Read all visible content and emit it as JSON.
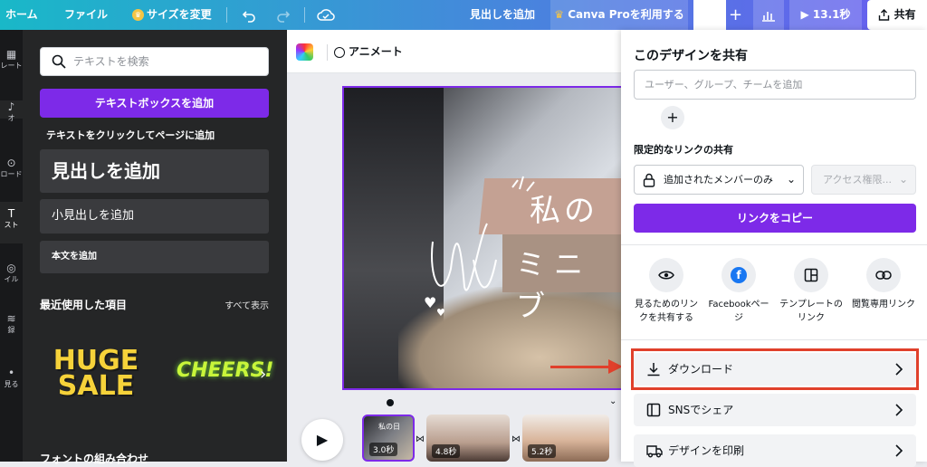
{
  "topbar": {
    "home": "ホーム",
    "file": "ファイル",
    "resize": "サイズを変更",
    "heading_add": "見出しを追加",
    "canva_pro": "Canva Proを利用する",
    "play_time": "13.1秒",
    "share": "共有"
  },
  "rail": {
    "items": [
      "レート",
      "オ",
      "ロード",
      "スト",
      "イル",
      "録",
      "見る"
    ]
  },
  "left_panel": {
    "search_placeholder": "テキストを検索",
    "add_textbox": "テキストボックスを追加",
    "hint": "テキストをクリックしてページに追加",
    "heading": "見出しを追加",
    "subheading": "小見出しを追加",
    "body": "本文を追加",
    "recent_title": "最近使用した項目",
    "see_all": "すべて表示",
    "sticker1_line1": "HUGE",
    "sticker1_line2": "SALE",
    "sticker2": "CHEERS!",
    "font_combo": "フォントの組み合わせ"
  },
  "canvas": {
    "animate": "アニメート",
    "title_text": "私の日",
    "subtitle_text": "ミニブ",
    "thumb1_duration": "3.0秒",
    "thumb2_duration": "4.8秒",
    "thumb3_duration": "5.2秒",
    "thumb1_caption": "私の日"
  },
  "share_sheet": {
    "title": "このデザインを共有",
    "invite_placeholder": "ユーザー、グループ、チームを追加",
    "limited_link_title": "限定的なリンクの共有",
    "members_only": "追加されたメンバーのみ",
    "access_placeholder": "アクセス権限...",
    "copy_link": "リンクをコピー",
    "options": [
      {
        "label": "見るためのリンクを共有する",
        "icon": "eye-icon"
      },
      {
        "label": "Facebookページ",
        "icon": "facebook-icon"
      },
      {
        "label": "テンプレートのリンク",
        "icon": "template-icon"
      },
      {
        "label": "閲覧専用リンク",
        "icon": "link-icon"
      }
    ],
    "download": "ダウンロード",
    "sns_share": "SNSでシェア",
    "print": "デザインを印刷"
  },
  "colors": {
    "accent_purple": "#7d2ae8",
    "highlight_red": "#e0402b"
  }
}
